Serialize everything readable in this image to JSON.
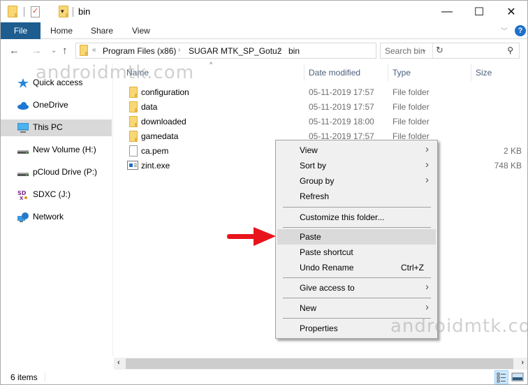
{
  "window": {
    "title": "bin",
    "controls": {
      "minimize": "—",
      "maximize": "☐",
      "close": "✕"
    }
  },
  "ribbon": {
    "tabs": [
      {
        "label": "File",
        "active": true
      },
      {
        "label": "Home"
      },
      {
        "label": "Share"
      },
      {
        "label": "View"
      }
    ],
    "help_label": "?",
    "accent_color": "#1e5d8f"
  },
  "nav": {
    "back": "←",
    "forward": "→",
    "recent": "⌄",
    "up": "↑",
    "breadcrumb": {
      "overflow": "«",
      "items": [
        "Program Files (x86)",
        "SUGAR MTK_SP_Gotu2",
        "bin"
      ]
    },
    "search_placeholder": "Search bin"
  },
  "sidebar": {
    "items": [
      {
        "label": "Quick access",
        "icon": "star-icon"
      },
      {
        "label": "OneDrive",
        "icon": "cloud-icon"
      },
      {
        "label": "This PC",
        "icon": "computer-icon",
        "selected": true
      },
      {
        "label": "New Volume (H:)",
        "icon": "drive-icon"
      },
      {
        "label": "pCloud Drive (P:)",
        "icon": "drive-icon"
      },
      {
        "label": "SDXC (J:)",
        "icon": "sd-card-icon"
      },
      {
        "label": "Network",
        "icon": "network-icon"
      }
    ]
  },
  "filelist": {
    "columns": [
      "Name",
      "Date modified",
      "Type",
      "Size"
    ],
    "rows": [
      {
        "name": "configuration",
        "date": "05-11-2019 17:57",
        "type": "File folder",
        "size": "",
        "icon": "folder"
      },
      {
        "name": "data",
        "date": "05-11-2019 17:57",
        "type": "File folder",
        "size": "",
        "icon": "folder"
      },
      {
        "name": "downloaded",
        "date": "05-11-2019 18:00",
        "type": "File folder",
        "size": "",
        "icon": "folder"
      },
      {
        "name": "gamedata",
        "date": "05-11-2019 17:57",
        "type": "File folder",
        "size": "",
        "icon": "folder"
      },
      {
        "name": "ca.pem",
        "date": "",
        "type": "",
        "size": "2 KB",
        "icon": "file"
      },
      {
        "name": "zint.exe",
        "date": "",
        "type": "",
        "size": "748 KB",
        "icon": "exe"
      }
    ]
  },
  "context_menu": {
    "items": [
      {
        "label": "View",
        "submenu": true
      },
      {
        "label": "Sort by",
        "submenu": true
      },
      {
        "label": "Group by",
        "submenu": true
      },
      {
        "label": "Refresh"
      },
      {
        "separator": true
      },
      {
        "label": "Customize this folder..."
      },
      {
        "separator": true
      },
      {
        "label": "Paste",
        "highlighted": true
      },
      {
        "label": "Paste shortcut"
      },
      {
        "label": "Undo Rename",
        "shortcut": "Ctrl+Z"
      },
      {
        "separator": true
      },
      {
        "label": "Give access to",
        "submenu": true
      },
      {
        "separator": true
      },
      {
        "label": "New",
        "submenu": true
      },
      {
        "separator": true
      },
      {
        "label": "Properties"
      }
    ],
    "pointer_color": "#e8141b"
  },
  "status": {
    "item_count": "6 items"
  },
  "watermark": "androidmtk.com"
}
